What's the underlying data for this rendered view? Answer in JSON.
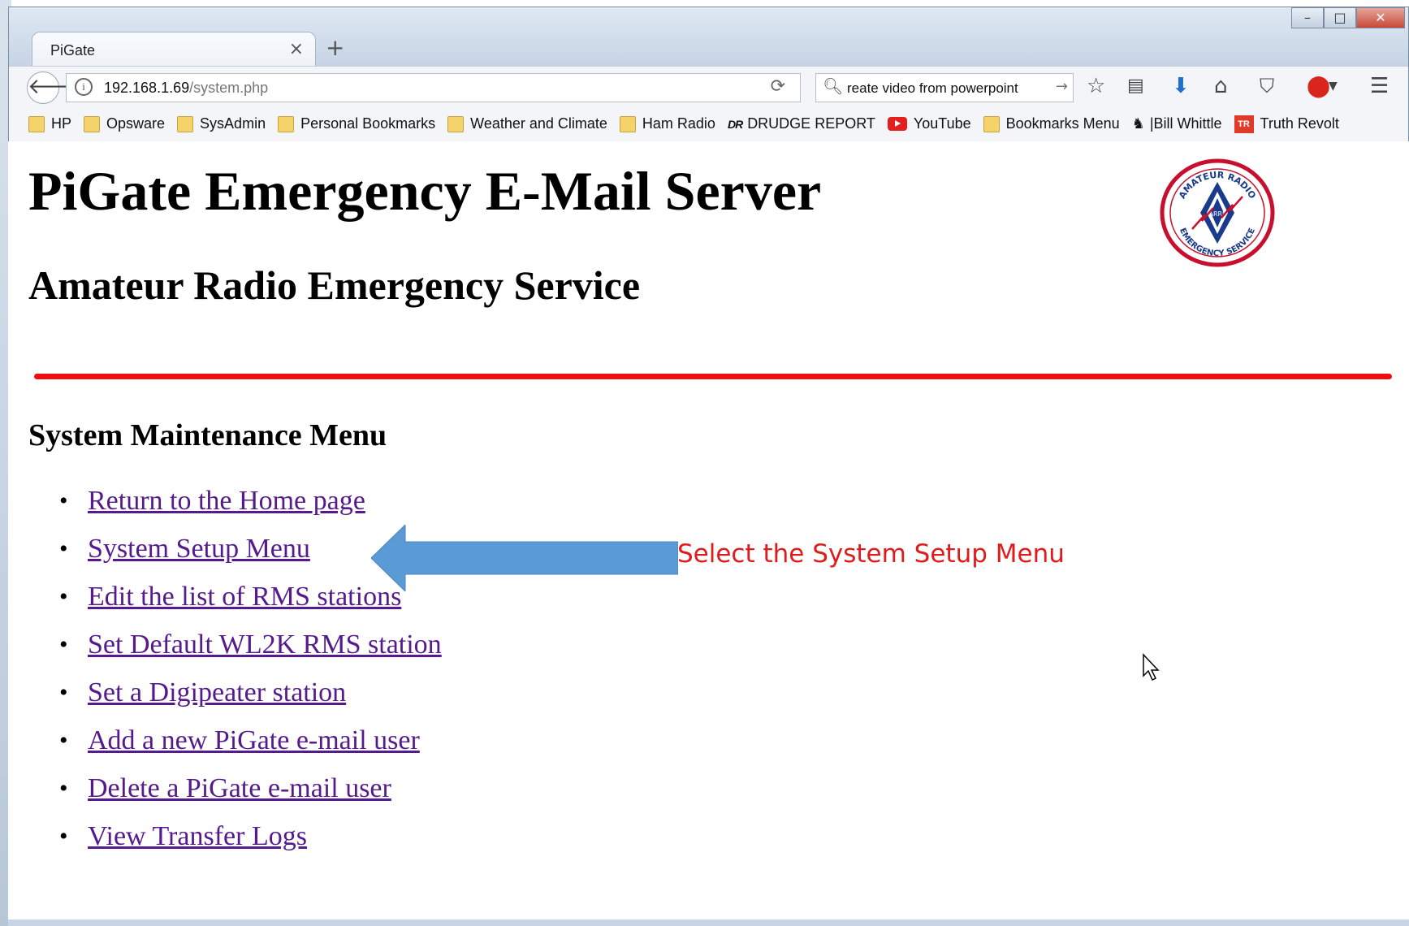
{
  "browser": {
    "tab": {
      "title": "PiGate",
      "close": "×"
    },
    "new_tab": "+",
    "window_buttons": {
      "minimize": "–",
      "maximize": "□",
      "close": "✕"
    },
    "url": {
      "host": "192.168.1.69",
      "path": "/system.php"
    },
    "search": {
      "value": "reate video from powerpoint",
      "go": "→"
    },
    "bookmarks": [
      {
        "label": "HP",
        "icon": "folder-icon"
      },
      {
        "label": "Opsware",
        "icon": "folder-icon"
      },
      {
        "label": "SysAdmin",
        "icon": "folder-icon"
      },
      {
        "label": "Personal Bookmarks",
        "icon": "folder-icon"
      },
      {
        "label": "Weather and Climate",
        "icon": "folder-icon"
      },
      {
        "label": "Ham Radio",
        "icon": "folder-icon"
      },
      {
        "label": "DRUDGE REPORT",
        "icon": "drudge-icon"
      },
      {
        "label": "YouTube",
        "icon": "youtube-icon"
      },
      {
        "label": "Bookmarks Menu",
        "icon": "folder-icon"
      },
      {
        "label": "|Bill Whittle",
        "icon": "bill-whittle-icon"
      },
      {
        "label": "Truth Revolt",
        "icon": "truth-revolt-icon"
      }
    ]
  },
  "page": {
    "title": "PiGate Emergency E-Mail Server",
    "subtitle": "Amateur Radio Emergency Service",
    "logo": {
      "top_text": "AMATEUR RADIO",
      "bottom_text": "EMERGENCY SERVICE",
      "center": "ARRL"
    },
    "section_title": "System Maintenance Menu",
    "menu": [
      "Return to the Home page",
      "System Setup Menu",
      "Edit the list of RMS stations",
      "Set Default WL2K RMS station",
      "Set a Digipeater station",
      "Add a new PiGate e-mail user",
      "Delete a PiGate e-mail user",
      "View Transfer Logs"
    ],
    "annotation": "Select the System Setup Menu"
  },
  "colors": {
    "rule": "#f20c0c",
    "link": "#551a8b",
    "arrow": "#5b9bd5",
    "annotation": "#e01b1b"
  }
}
